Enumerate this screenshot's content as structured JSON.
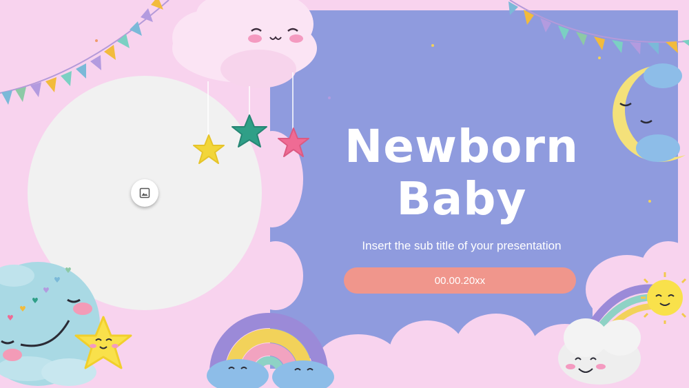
{
  "slide": {
    "title_line1": "Newborn",
    "title_line2": "Baby",
    "subtitle": "Insert the sub title of your presentation",
    "date": "00.00.20xx"
  },
  "placeholder": {
    "icon": "image-icon"
  },
  "colors": {
    "background_pink": "#f8d3ee",
    "panel_periwinkle": "#8f9bde",
    "date_pill": "#f0968c",
    "text_white": "#ffffff"
  }
}
